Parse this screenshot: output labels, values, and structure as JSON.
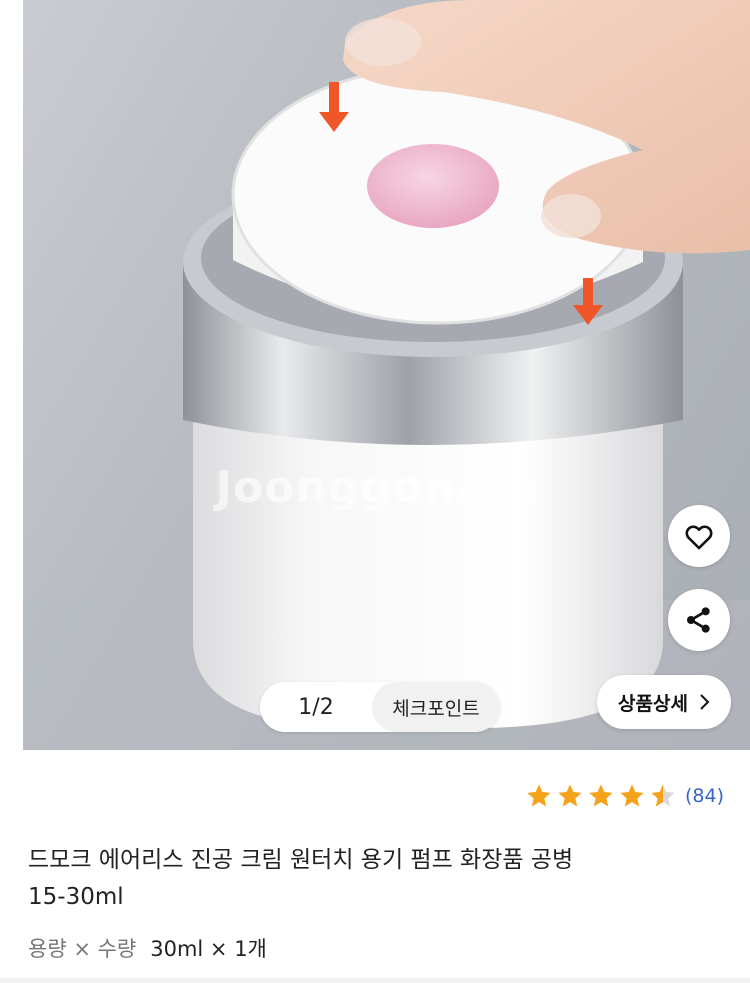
{
  "image": {
    "alt": "",
    "watermark": "Joonggonara"
  },
  "pager": {
    "counter": "1/2",
    "chip_label": "체크포인트"
  },
  "actions": {
    "like_icon": "heart-icon",
    "share_icon": "share-icon",
    "detail_label": "상품상세"
  },
  "rating": {
    "stars": 4.5,
    "count": "(84)",
    "star_color": "#f4a31a"
  },
  "product": {
    "title_line1": "드모크 에어리스 진공 크림 원터치 용기 펌프 화장품 공병",
    "title_line2": "15-30ml"
  },
  "option": {
    "label": "용량 × 수량",
    "value": "30ml × 1개"
  }
}
